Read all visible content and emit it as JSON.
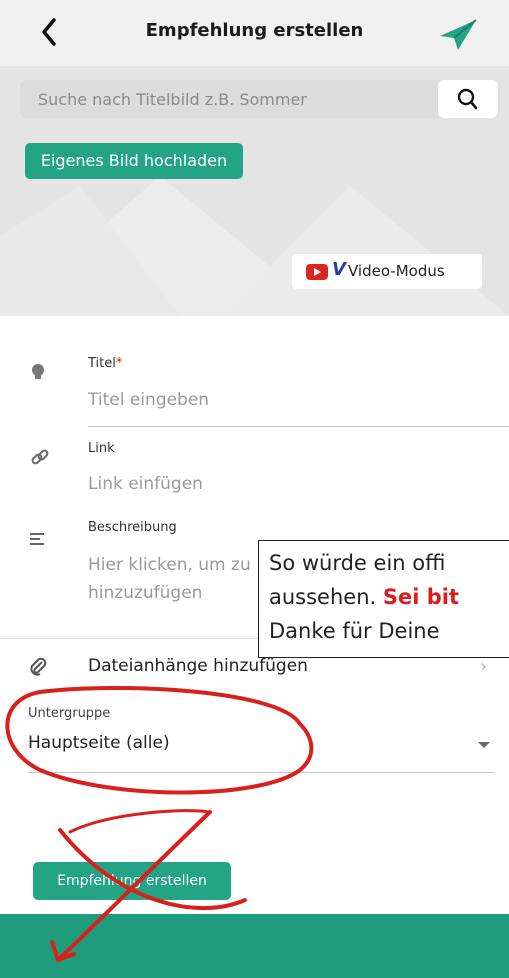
{
  "header": {
    "title": "Empfehlung erstellen"
  },
  "hero": {
    "search_placeholder": "Suche nach Titelbild z.B. Sommer",
    "upload_label": "Eigenes Bild hochladen",
    "video_mode_label": "Video-Modus"
  },
  "form": {
    "title": {
      "label": "Titel",
      "required_mark": "*",
      "placeholder": "Titel eingeben"
    },
    "link": {
      "label": "Link",
      "placeholder": "Link einfügen"
    },
    "description": {
      "label": "Beschreibung",
      "placeholder_line1": "Hier klicken, um zu",
      "placeholder_line2": "hinzuzufügen"
    },
    "attachments_label": "Dateianhänge hinzufügen",
    "subgroup": {
      "label": "Untergruppe",
      "value": "Hauptseite (alle)"
    },
    "create_label": "Empfehlung erstellen"
  },
  "overlay": {
    "line1": "So würde ein offi",
    "line2_a": "aussehen",
    "line2_b": ". ",
    "line2_red": "Sei bit",
    "line3": "Danke für Deine"
  },
  "colors": {
    "accent": "#23a484",
    "footer": "#1f9c7b",
    "annotation": "#d8201c"
  }
}
